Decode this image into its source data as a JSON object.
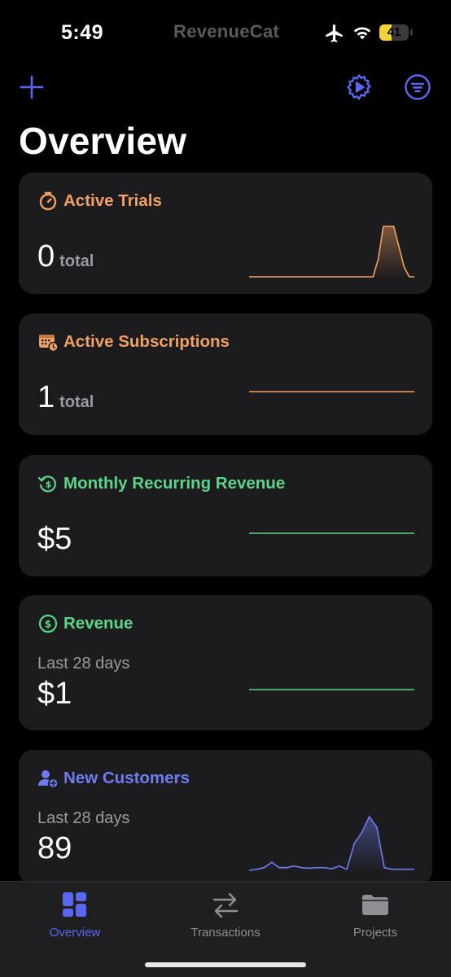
{
  "status_bar": {
    "time": "5:49",
    "brand": "RevenueCat",
    "battery_level": "41",
    "battery_percent": 41
  },
  "toolbar": {
    "add_icon": "plus-icon",
    "settings_icon": "gear-play-icon",
    "filter_icon": "filter-circle-icon",
    "accent_color": "#5a67f0"
  },
  "page": {
    "title": "Overview"
  },
  "cards": [
    {
      "title": "Active Trials",
      "icon": "timer-icon",
      "value": "0",
      "unit": "total",
      "color": "#f0a060",
      "sparkline": [
        0,
        0,
        0,
        0,
        0,
        0,
        0,
        0,
        0,
        0,
        0,
        0,
        0,
        0,
        0,
        0,
        0,
        0,
        0,
        0,
        0,
        0,
        0,
        0,
        0,
        0.35,
        1,
        1,
        1,
        0.6,
        0.2,
        0,
        0
      ]
    },
    {
      "title": "Active Subscriptions",
      "icon": "calendar-badge-icon",
      "value": "1",
      "unit": "total",
      "color": "#f0a060",
      "sparkline": [
        1,
        1,
        1,
        1,
        1,
        1,
        1,
        1,
        1,
        1,
        1,
        1
      ]
    },
    {
      "title": "Monthly Recurring Revenue",
      "icon": "dollar-cycle-icon",
      "value": "$5",
      "color": "#5bd589",
      "sparkline": [
        1,
        1,
        1,
        1,
        1,
        1,
        1,
        1,
        1,
        1,
        1,
        1
      ]
    },
    {
      "title": "Revenue",
      "icon": "dollar-circle-icon",
      "subtitle": "Last 28 days",
      "value": "$1",
      "color": "#5bd589",
      "sparkline": [
        0,
        0,
        0,
        0,
        0,
        0,
        0,
        0,
        0,
        0,
        0,
        0
      ]
    },
    {
      "title": "New Customers",
      "icon": "person-add-icon",
      "subtitle": "Last 28 days",
      "value": "89",
      "color": "#6e7cf0",
      "sparkline": [
        0,
        0.02,
        0.05,
        0.15,
        0.05,
        0.05,
        0.08,
        0.05,
        0.04,
        0.05,
        0.05,
        0.03,
        0.08,
        0.02,
        0.5,
        0.7,
        1,
        0.8,
        0.05,
        0.02,
        0.02,
        0.02,
        0.02
      ]
    }
  ],
  "tabs": [
    {
      "label": "Overview",
      "icon": "dashboard-grid-icon",
      "active": true
    },
    {
      "label": "Transactions",
      "icon": "arrows-left-right-icon",
      "active": false
    },
    {
      "label": "Projects",
      "icon": "folder-icon",
      "active": false
    }
  ],
  "colors": {
    "background": "#000000",
    "card": "#1c1c1e",
    "active_tab": "#5a67f0",
    "inactive_tab": "#8e8e93"
  }
}
